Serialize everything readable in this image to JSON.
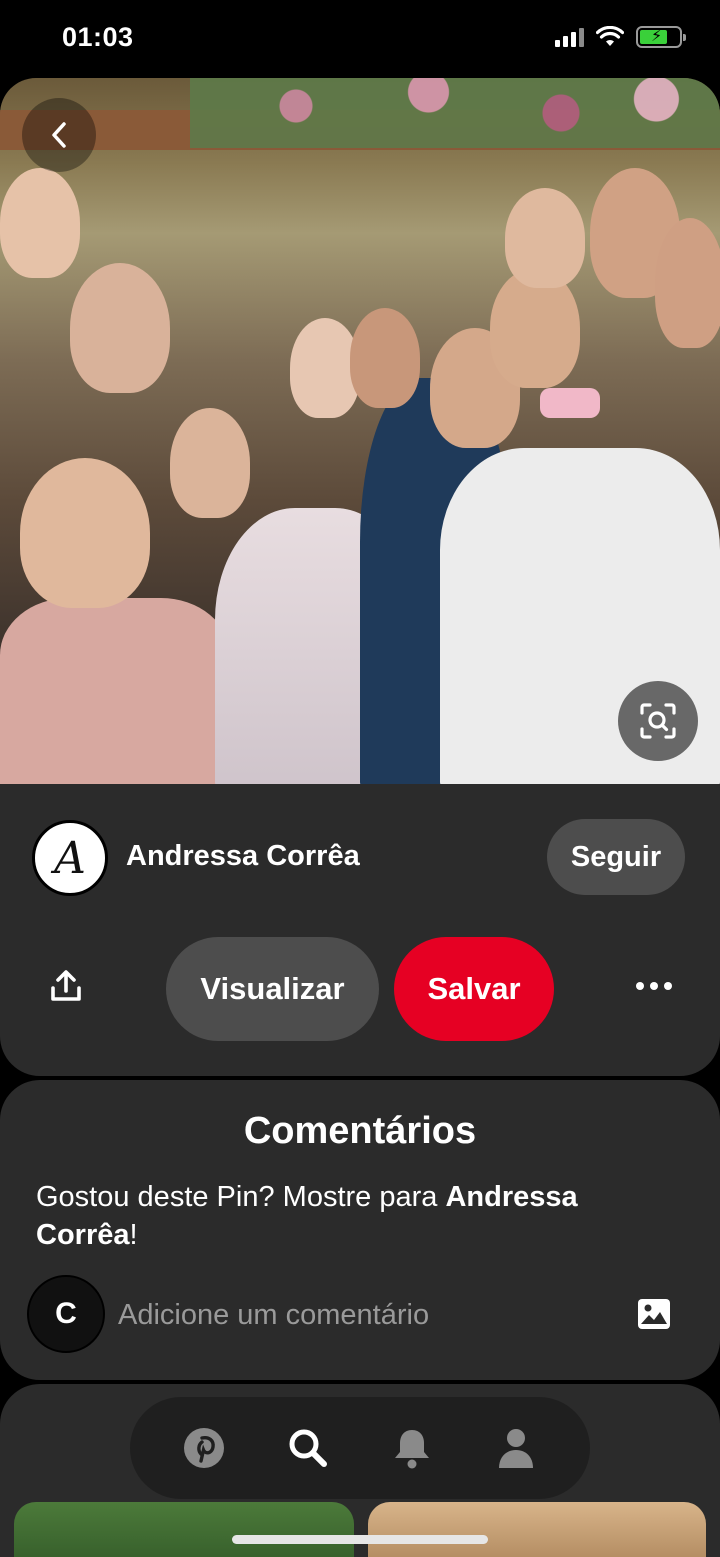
{
  "status_bar": {
    "time": "01:03"
  },
  "pin": {
    "author_initial": "A",
    "author_name": "Andressa Corrêa",
    "follow_label": "Seguir",
    "view_label": "Visualizar",
    "save_label": "Salvar"
  },
  "comments": {
    "title": "Comentários",
    "prompt_prefix": "Gostou deste Pin? Mostre para ",
    "prompt_name": "Andressa Corrêa",
    "prompt_suffix": "!",
    "user_initial": "C",
    "input_placeholder": "Adicione um comentário"
  },
  "bottom_nav": {
    "items": [
      "pinterest-home-icon",
      "search-icon",
      "notifications-bell-icon",
      "profile-icon"
    ]
  },
  "colors": {
    "accent_red": "#e60023",
    "card_bg": "#2b2b2b",
    "button_gray": "#4d4d4d"
  }
}
